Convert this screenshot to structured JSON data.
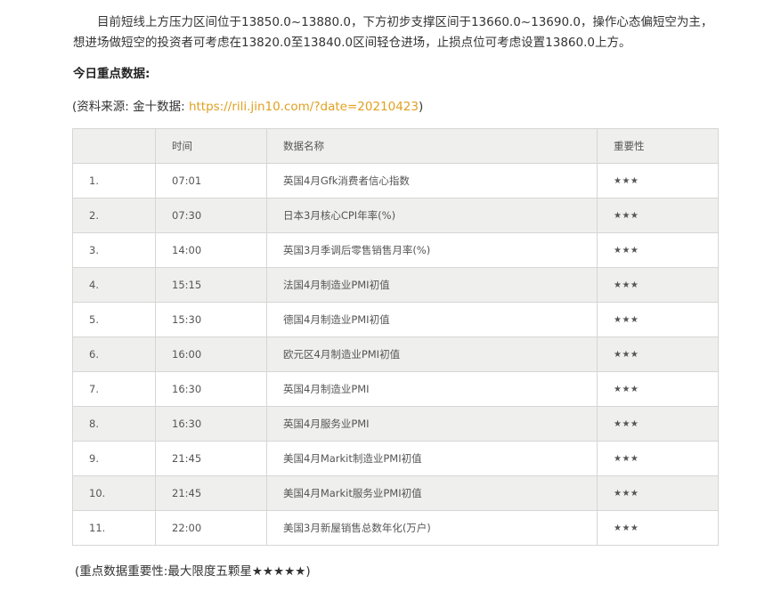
{
  "article": {
    "paragraph": "目前短线上方压力区间位于13850.0~13880.0，下方初步支撑区间于13660.0~13690.0，操作心态偏短空为主，想进场做短空的投资者可考虑在13820.0至13840.0区间轻仓进场，止损点位可考虑设置13860.0上方。",
    "heading": "今日重点数据:",
    "source_prefix": "(资料来源: 金十数据: ",
    "source_link": "https://rili.jin10.com/?date=20210423",
    "source_suffix": ")",
    "note": "(重点数据重要性:最大限度五颗星★★★★★)"
  },
  "table": {
    "headers": [
      "",
      "时间",
      "数据名称",
      "重要性"
    ],
    "rows": [
      {
        "no": "1.",
        "time": "07:01",
        "name": "英国4月Gfk消费者信心指数",
        "importance": "★★★"
      },
      {
        "no": "2.",
        "time": "07:30",
        "name": "日本3月核心CPI年率(%)",
        "importance": "★★★"
      },
      {
        "no": "3.",
        "time": "14:00",
        "name": "英国3月季调后零售销售月率(%)",
        "importance": "★★★"
      },
      {
        "no": "4.",
        "time": "15:15",
        "name": "法国4月制造业PMI初值",
        "importance": "★★★"
      },
      {
        "no": "5.",
        "time": "15:30",
        "name": "德国4月制造业PMI初值",
        "importance": "★★★"
      },
      {
        "no": "6.",
        "time": "16:00",
        "name": "欧元区4月制造业PMI初值",
        "importance": "★★★"
      },
      {
        "no": "7.",
        "time": "16:30",
        "name": "英国4月制造业PMI",
        "importance": "★★★"
      },
      {
        "no": "8.",
        "time": "16:30",
        "name": "英国4月服务业PMI",
        "importance": "★★★"
      },
      {
        "no": "9.",
        "time": "21:45",
        "name": "美国4月Markit制造业PMI初值",
        "importance": "★★★"
      },
      {
        "no": "10.",
        "time": "21:45",
        "name": "美国4月Markit服务业PMI初值",
        "importance": "★★★"
      },
      {
        "no": "11.",
        "time": "22:00",
        "name": "美国3月新屋销售总数年化(万户)",
        "importance": "★★★"
      }
    ]
  },
  "colors": {
    "link": "#e0a020",
    "row_alt_bg": "#efefed",
    "border": "#d6d6d6"
  }
}
